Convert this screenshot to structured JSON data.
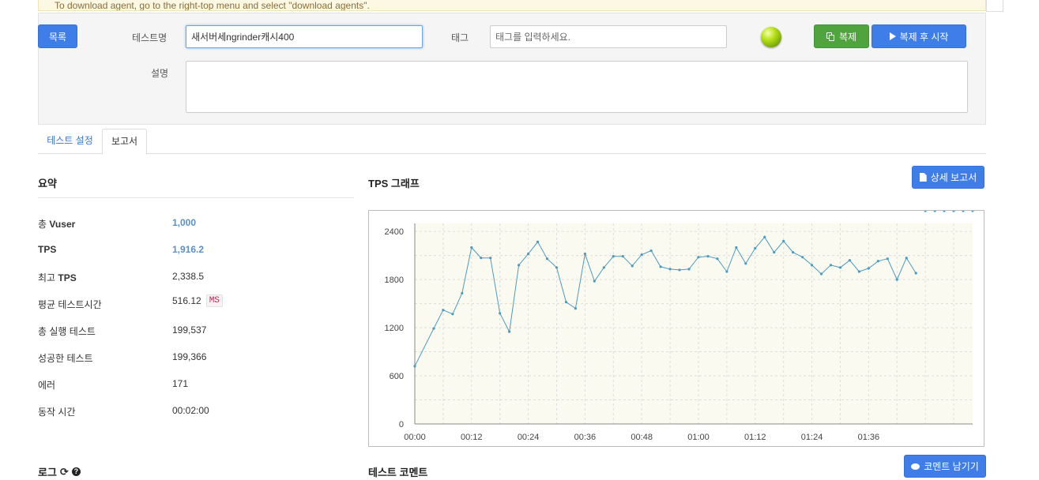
{
  "banner": {
    "text": "To download agent, go to the right-top menu and select \"download agents\"."
  },
  "form": {
    "list_button": "목록",
    "test_name_label": "테스트명",
    "test_name_value": "새서버세ngrinder캐시400",
    "tag_label": "태그",
    "tag_placeholder": "태그를 입력하세요.",
    "clone_button": "복제",
    "clone_start_button": "복제 후 시작",
    "description_label": "설명",
    "description_value": ""
  },
  "tabs": [
    {
      "label": "테스트 설정",
      "active": false
    },
    {
      "label": "보고서",
      "active": true
    }
  ],
  "summary": {
    "title": "요약",
    "rows": [
      {
        "label_plain": "총 ",
        "label_bold": "Vuser",
        "value": "1,000"
      },
      {
        "label_plain": "",
        "label_bold": "TPS",
        "value": "1,916.2"
      },
      {
        "label_plain": "최고 ",
        "label_bold": "TPS",
        "value": "2,338.5"
      },
      {
        "label_plain": "평균 테스트시간",
        "label_bold": "",
        "value": "516.12",
        "unit": "MS"
      },
      {
        "label_plain": "총 실행 테스트",
        "label_bold": "",
        "value": "199,537"
      },
      {
        "label_plain": "성공한 테스트",
        "label_bold": "",
        "value": "199,366"
      },
      {
        "label_plain": "에러",
        "label_bold": "",
        "value": "171"
      },
      {
        "label_plain": "동작 시간",
        "label_bold": "",
        "value": "00:02:00"
      }
    ]
  },
  "tps_section": {
    "title": "TPS 그래프",
    "detail_button": "상세 보고서"
  },
  "log_section": {
    "title": "로그"
  },
  "comment_section": {
    "title": "테스트 코멘트",
    "button": "코멘트 남기기"
  },
  "colors": {
    "primary": "#3f7ee8",
    "success": "#4fa43d",
    "series": "#4a9bc1",
    "plot_bg": "#fbfaf0"
  },
  "chart_data": {
    "type": "line",
    "x_tick_labels": [
      "00:00",
      "00:12",
      "00:24",
      "00:36",
      "00:48",
      "01:00",
      "01:12",
      "01:24",
      "01:36"
    ],
    "y_tick_labels": [
      "0",
      "600",
      "1200",
      "1800",
      "2400"
    ],
    "xlim_seconds": [
      0,
      118
    ],
    "ylim": [
      0,
      2500
    ],
    "grid": true,
    "x_seconds": [
      0,
      4,
      6,
      8,
      10,
      12,
      14,
      16,
      18,
      20,
      22,
      24,
      26,
      28,
      30,
      32,
      34,
      36,
      38,
      40,
      42,
      44,
      46,
      48,
      50,
      52,
      54,
      56,
      58,
      60,
      62,
      64,
      66,
      68,
      70,
      72,
      74,
      76,
      78,
      80,
      82,
      84,
      86,
      88,
      90,
      92,
      94,
      96,
      98,
      100,
      102,
      104,
      106,
      108,
      110,
      112,
      114,
      116,
      118
    ],
    "series": [
      {
        "values": [
          720,
          1190,
          1420,
          1370,
          1630,
          2200,
          2070,
          2070,
          1380,
          1150,
          1980,
          2120,
          2270,
          2060,
          1950,
          1520,
          1440,
          2120,
          1780,
          1950,
          2090,
          2090,
          1970,
          2110,
          2160,
          1960,
          1930,
          1920,
          1930,
          2080,
          2090,
          2060,
          1900,
          2200,
          2000,
          2190,
          2330,
          2140,
          2280,
          2140,
          2080,
          1980,
          1870,
          1980,
          1950,
          2040,
          1900,
          1940,
          2030,
          2060,
          1800,
          2070,
          1880
        ]
      }
    ]
  }
}
